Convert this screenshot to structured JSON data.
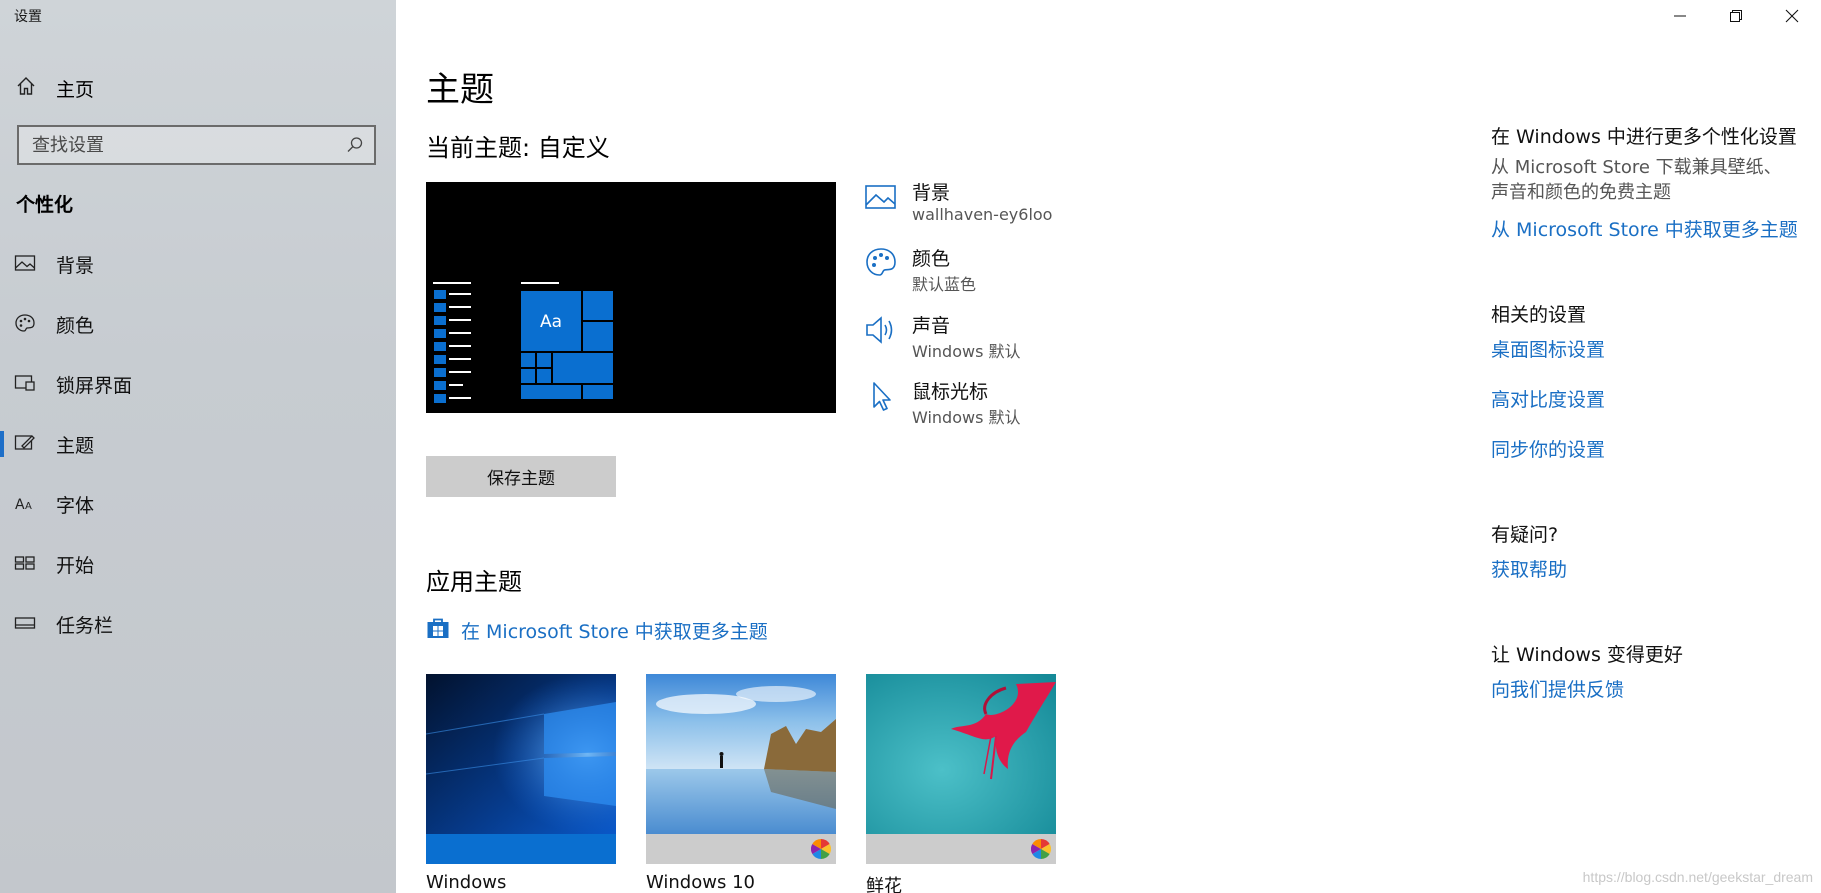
{
  "window": {
    "title": "设置",
    "controls": {
      "minimize": "minimize-icon",
      "restore": "restore-icon",
      "close": "close-icon"
    }
  },
  "sidebar": {
    "home_label": "主页",
    "search_placeholder": "查找设置",
    "section_title": "个性化",
    "items": [
      {
        "label": "背景",
        "icon": "picture-icon"
      },
      {
        "label": "颜色",
        "icon": "palette-icon"
      },
      {
        "label": "锁屏界面",
        "icon": "lock-screen-icon"
      },
      {
        "label": "主题",
        "icon": "theme-icon",
        "selected": true
      },
      {
        "label": "字体",
        "icon": "font-icon"
      },
      {
        "label": "开始",
        "icon": "start-icon"
      },
      {
        "label": "任务栏",
        "icon": "taskbar-icon"
      }
    ]
  },
  "main": {
    "title": "主题",
    "current_theme": "当前主题: 自定义",
    "preview_tile_label": "Aa",
    "properties": [
      {
        "name": "背景",
        "value": "wallhaven-ey6loo",
        "icon": "picture-icon"
      },
      {
        "name": "颜色",
        "value": "默认蓝色",
        "icon": "palette-icon"
      },
      {
        "name": "声音",
        "value": "Windows 默认",
        "icon": "speaker-icon"
      },
      {
        "name": "鼠标光标",
        "value": "Windows 默认",
        "icon": "cursor-icon"
      }
    ],
    "save_button": "保存主题",
    "apply_title": "应用主题",
    "store_link": "在 Microsoft Store 中获取更多主题",
    "themes": [
      {
        "name": "Windows",
        "band_color": "#0a6fd0"
      },
      {
        "name": "Windows 10",
        "band_color": "#cccccc"
      },
      {
        "name": "鲜花",
        "band_color": "#cccccc"
      }
    ]
  },
  "right": {
    "more_heading": "在 Windows 中进行更多个性化设置",
    "more_desc_1": "从 Microsoft Store 下载兼具壁纸、",
    "more_desc_2": "声音和颜色的免费主题",
    "more_link": "从 Microsoft Store 中获取更多主题",
    "related_heading": "相关的设置",
    "related_links": [
      "桌面图标设置",
      "高对比度设置",
      "同步你的设置"
    ],
    "question_heading": "有疑问?",
    "help_link": "获取帮助",
    "improve_heading": "让 Windows 变得更好",
    "feedback_link": "向我们提供反馈"
  },
  "colors": {
    "accent": "#1a6fc4",
    "tile_blue": "#0a6fd0"
  },
  "watermark": "https://blog.csdn.net/geekstar_dream"
}
